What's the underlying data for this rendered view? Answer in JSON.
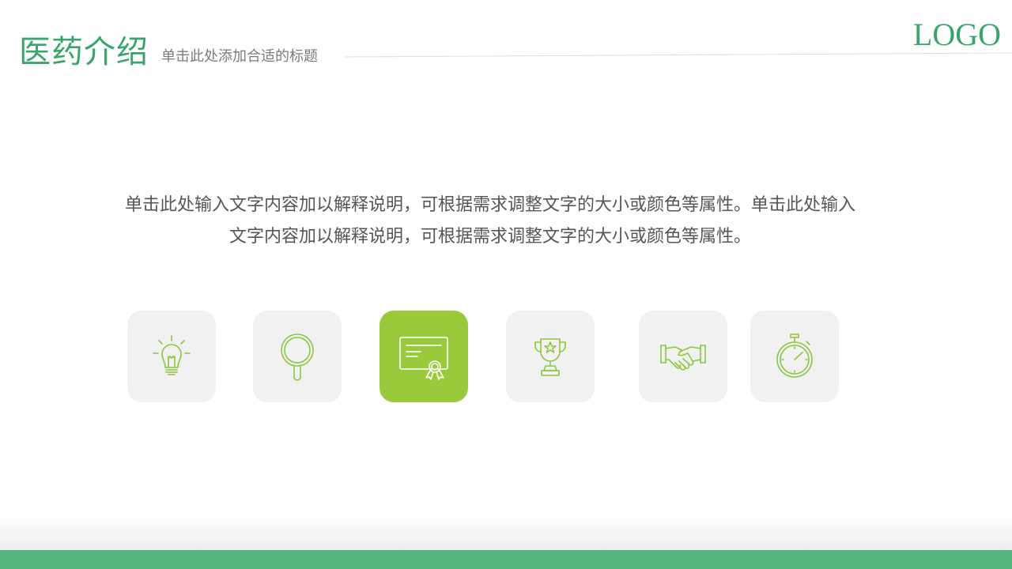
{
  "header": {
    "title": "医药介绍",
    "subtitle": "单击此处添加合适的标题",
    "logo": "LOGO"
  },
  "content": {
    "line1": "单击此处输入文字内容加以解释说明，可根据需求调整文字的大小或颜色等属性。单击此处输入",
    "line2": "文字内容加以解释说明，可根据需求调整文字的大小或颜色等属性。"
  },
  "icons": [
    {
      "name": "lightbulb-icon",
      "active": false
    },
    {
      "name": "magnifier-icon",
      "active": false
    },
    {
      "name": "certificate-icon",
      "active": true
    },
    {
      "name": "trophy-icon",
      "active": false
    },
    {
      "name": "handshake-icon",
      "active": false
    },
    {
      "name": "stopwatch-icon",
      "active": false
    }
  ],
  "colors": {
    "brand_green": "#3aa56b",
    "icon_green": "#8cc63f",
    "active_tile": "#9aca3c",
    "tile_bg": "#f1f1f1",
    "footer_bar": "#57b47f",
    "body_text": "#555555"
  }
}
